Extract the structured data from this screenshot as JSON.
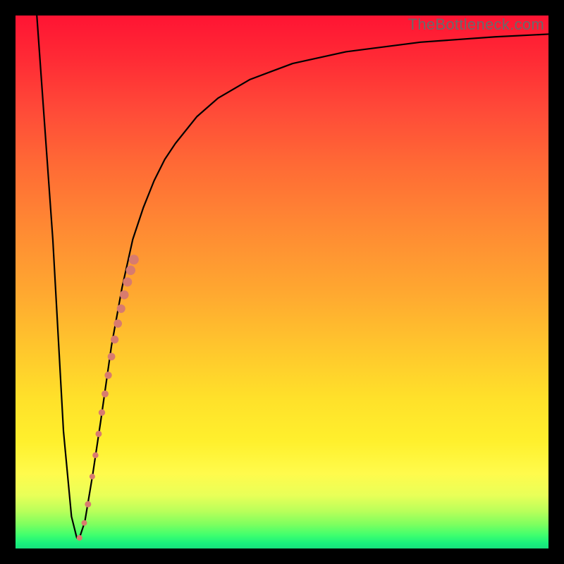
{
  "watermark": "TheBottleneck.com",
  "chart_data": {
    "type": "line",
    "title": "",
    "xlabel": "",
    "ylabel": "",
    "xlim": [
      0,
      100
    ],
    "ylim": [
      0,
      100
    ],
    "grid": false,
    "series": [
      {
        "name": "curve",
        "x": [
          4,
          7,
          9,
          10.5,
          11.5,
          12,
          13,
          14.5,
          16,
          18,
          20,
          22,
          24,
          26,
          28,
          30,
          34,
          38,
          44,
          52,
          62,
          76,
          90,
          100
        ],
        "y": [
          100,
          58,
          22,
          6,
          2,
          2,
          5,
          14,
          24,
          38,
          49,
          58,
          64,
          69,
          73,
          76,
          81,
          84.5,
          88,
          91,
          93.2,
          95,
          96,
          96.5
        ]
      }
    ],
    "markers": [
      {
        "name": "highlight-segment",
        "x": [
          14.4,
          15.0,
          15.6,
          16.2,
          16.8,
          17.4,
          18.0,
          18.6,
          19.2,
          19.8,
          20.4,
          21.0,
          21.6,
          22.2
        ],
        "y": [
          13.5,
          17.5,
          21.5,
          25.5,
          29.0,
          32.5,
          36.0,
          39.2,
          42.2,
          45.0,
          47.6,
          50.0,
          52.2,
          54.2
        ],
        "color": "#d87b6e",
        "size_start": 8,
        "size_end": 14
      },
      {
        "name": "dot-low-1",
        "x": [
          13.6
        ],
        "y": [
          8.3
        ],
        "color": "#d87b6e",
        "size": 9
      },
      {
        "name": "dot-low-2",
        "x": [
          12.9
        ],
        "y": [
          4.8
        ],
        "color": "#d87b6e",
        "size": 8
      },
      {
        "name": "dot-bottom",
        "x": [
          12.0
        ],
        "y": [
          2.0
        ],
        "color": "#d87b6e",
        "size": 8
      }
    ]
  }
}
